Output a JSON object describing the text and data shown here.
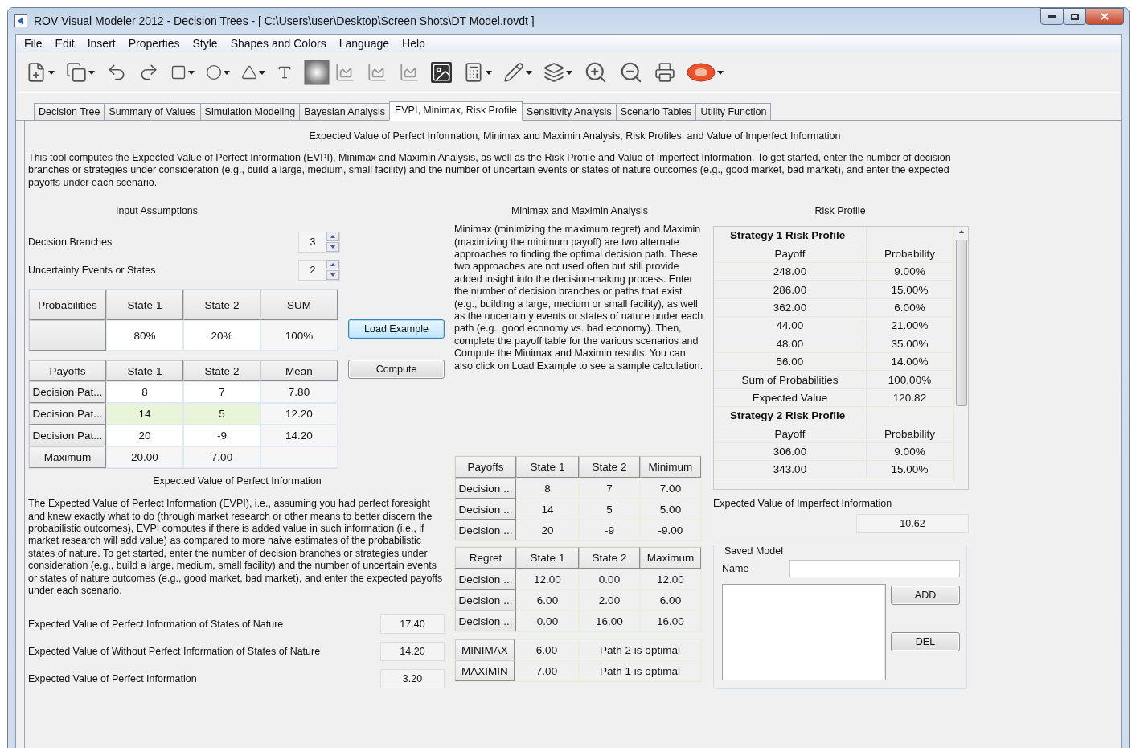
{
  "window": {
    "title": "ROV Visual Modeler 2012 - Decision Trees - [ C:\\Users\\user\\Desktop\\Screen Shots\\DT Model.rovdt ]"
  },
  "menu": [
    "File",
    "Edit",
    "Insert",
    "Properties",
    "Style",
    "Shapes and Colors",
    "Language",
    "Help"
  ],
  "tabs": [
    {
      "label": "Decision Tree",
      "selected": false
    },
    {
      "label": "Summary of Values",
      "selected": false
    },
    {
      "label": "Simulation Modeling",
      "selected": false
    },
    {
      "label": "Bayesian Analysis",
      "selected": false
    },
    {
      "label": "EVPI, Minimax, Risk Profile",
      "selected": true
    },
    {
      "label": "Sensitivity Analysis",
      "selected": false
    },
    {
      "label": "Scenario Tables",
      "selected": false
    },
    {
      "label": "Utility Function",
      "selected": false
    }
  ],
  "heading": "Expected Value of Perfect Information, Minimax and Maximin Analysis, Risk Profiles, and Value of Imperfect Information",
  "intro": "This tool computes the Expected Value of Perfect Information (EVPI), Minimax and Maximin Analysis, as well as the Risk Profile and Value of Imperfect Information. To get started, enter the number of decision branches or strategies under consideration (e.g., build a large, medium, small facility) and the number of uncertain events or states of nature outcomes (e.g., good market, bad market), and enter the expected payoffs under each scenario.",
  "input_assumptions": {
    "title": "Input Assumptions",
    "spinners": [
      {
        "label": "Decision Branches",
        "value": "3"
      },
      {
        "label": "Uncertainty Events or States",
        "value": "2"
      }
    ],
    "probabilities": {
      "columns": [
        "Probabilities",
        "State 1",
        "State 2",
        "SUM"
      ],
      "rows": [
        [
          "",
          "80%",
          "20%",
          "100%"
        ]
      ]
    },
    "payoffs": {
      "columns": [
        "Payoffs",
        "State 1",
        "State 2",
        "Mean"
      ],
      "rows": [
        {
          "cells": [
            "Decision Pat...",
            "8",
            "7",
            "7.80"
          ],
          "selected": false
        },
        {
          "cells": [
            "Decision Pat...",
            "14",
            "5",
            "12.20"
          ],
          "selected": true
        },
        {
          "cells": [
            "Decision Pat...",
            "20",
            "-9",
            "14.20"
          ],
          "selected": false
        },
        {
          "cells": [
            "Maximum",
            "20.00",
            "7.00"
          ],
          "selected": false
        }
      ]
    }
  },
  "buttons": [
    {
      "label": "Load Example",
      "focused": true
    },
    {
      "label": "Compute",
      "focused": false
    }
  ],
  "evpi": {
    "title": "Expected Value of Perfect Information",
    "text": "The Expected Value of Perfect Information (EVPI), i.e., assuming you had perfect foresight and knew exactly what to do (through market research or other means to better discern the probabilistic outcomes), EVPI computes if there is added value in such information (i.e., if market research will add value) as compared to more naive estimates of the probabilistic states of nature. To get started, enter the number of decision branches or strategies under consideration (e.g., build a large, medium, small facility) and the number of uncertain events or states of nature outcomes (e.g., good market, bad market), and enter the expected payoffs under each scenario.",
    "results": [
      {
        "label": "Expected Value of Perfect Information of States of Nature",
        "value": "17.40"
      },
      {
        "label": "Expected Value of Without Perfect Information of States of Nature",
        "value": "14.20"
      },
      {
        "label": "Expected Value of Perfect Information",
        "value": "3.20"
      }
    ]
  },
  "minimax": {
    "title": "Minimax and Maximin Analysis",
    "text": "Minimax (minimizing the maximum regret) and Maximin (maximizing the minimum payoff) are two alternate approaches to finding the optimal decision path. These two approaches are not used often but still provide added insight into the decision-making process. Enter the number of decision branches or paths that exist (e.g., building a large, medium or small facility), as well as the uncertainty events or states of nature under each path (e.g., good economy vs. bad economy). Then, complete the payoff table for the various scenarios and Compute the Minimax and Maximin results. You can also click on Load Example to see a sample calculation.",
    "payoffs": {
      "columns": [
        "Payoffs",
        "State 1",
        "State 2",
        "Minimum"
      ],
      "rows": [
        [
          "Decision ...",
          "8",
          "7",
          "7.00"
        ],
        [
          "Decision ...",
          "14",
          "5",
          "5.00"
        ],
        [
          "Decision ...",
          "20",
          "-9",
          "-9.00"
        ]
      ]
    },
    "regret": {
      "columns": [
        "Regret",
        "State 1",
        "State 2",
        "Maximum"
      ],
      "rows": [
        [
          "Decision ...",
          "12.00",
          "0.00",
          "12.00"
        ],
        [
          "Decision ...",
          "6.00",
          "2.00",
          "6.00"
        ],
        [
          "Decision ...",
          "0.00",
          "16.00",
          "16.00"
        ]
      ]
    },
    "summary": [
      [
        "MINIMAX",
        "6.00",
        "Path 2 is optimal"
      ],
      [
        "MAXIMIN",
        "7.00",
        "Path 1 is optimal"
      ]
    ]
  },
  "risk_profile": {
    "title": "Risk Profile",
    "rows": [
      {
        "kind": "heading",
        "cells": [
          "Strategy 1 Risk Profile"
        ]
      },
      {
        "kind": "row",
        "cells": [
          "Payoff",
          "Probability"
        ]
      },
      {
        "kind": "row",
        "cells": [
          "248.00",
          "9.00%"
        ]
      },
      {
        "kind": "row",
        "cells": [
          "286.00",
          "15.00%"
        ]
      },
      {
        "kind": "row",
        "cells": [
          "362.00",
          "6.00%"
        ]
      },
      {
        "kind": "row",
        "cells": [
          "44.00",
          "21.00%"
        ]
      },
      {
        "kind": "row",
        "cells": [
          "48.00",
          "35.00%"
        ]
      },
      {
        "kind": "row",
        "cells": [
          "56.00",
          "14.00%"
        ]
      },
      {
        "kind": "row",
        "cells": [
          "Sum of Probabilities",
          "100.00%"
        ]
      },
      {
        "kind": "row",
        "cells": [
          "Expected Value",
          "120.82"
        ]
      },
      {
        "kind": "heading",
        "cells": [
          "Strategy 2 Risk Profile"
        ]
      },
      {
        "kind": "row",
        "cells": [
          "Payoff",
          "Probability"
        ]
      },
      {
        "kind": "row",
        "cells": [
          "306.00",
          "9.00%"
        ]
      },
      {
        "kind": "row",
        "cells": [
          "343.00",
          "15.00%"
        ]
      }
    ]
  },
  "imperfect": {
    "label": "Expected Value of Imperfect Information",
    "value": "10.62"
  },
  "saved_model": {
    "title": "Saved Model",
    "name_label": "Name",
    "buttons": [
      "ADD",
      "DEL"
    ]
  }
}
